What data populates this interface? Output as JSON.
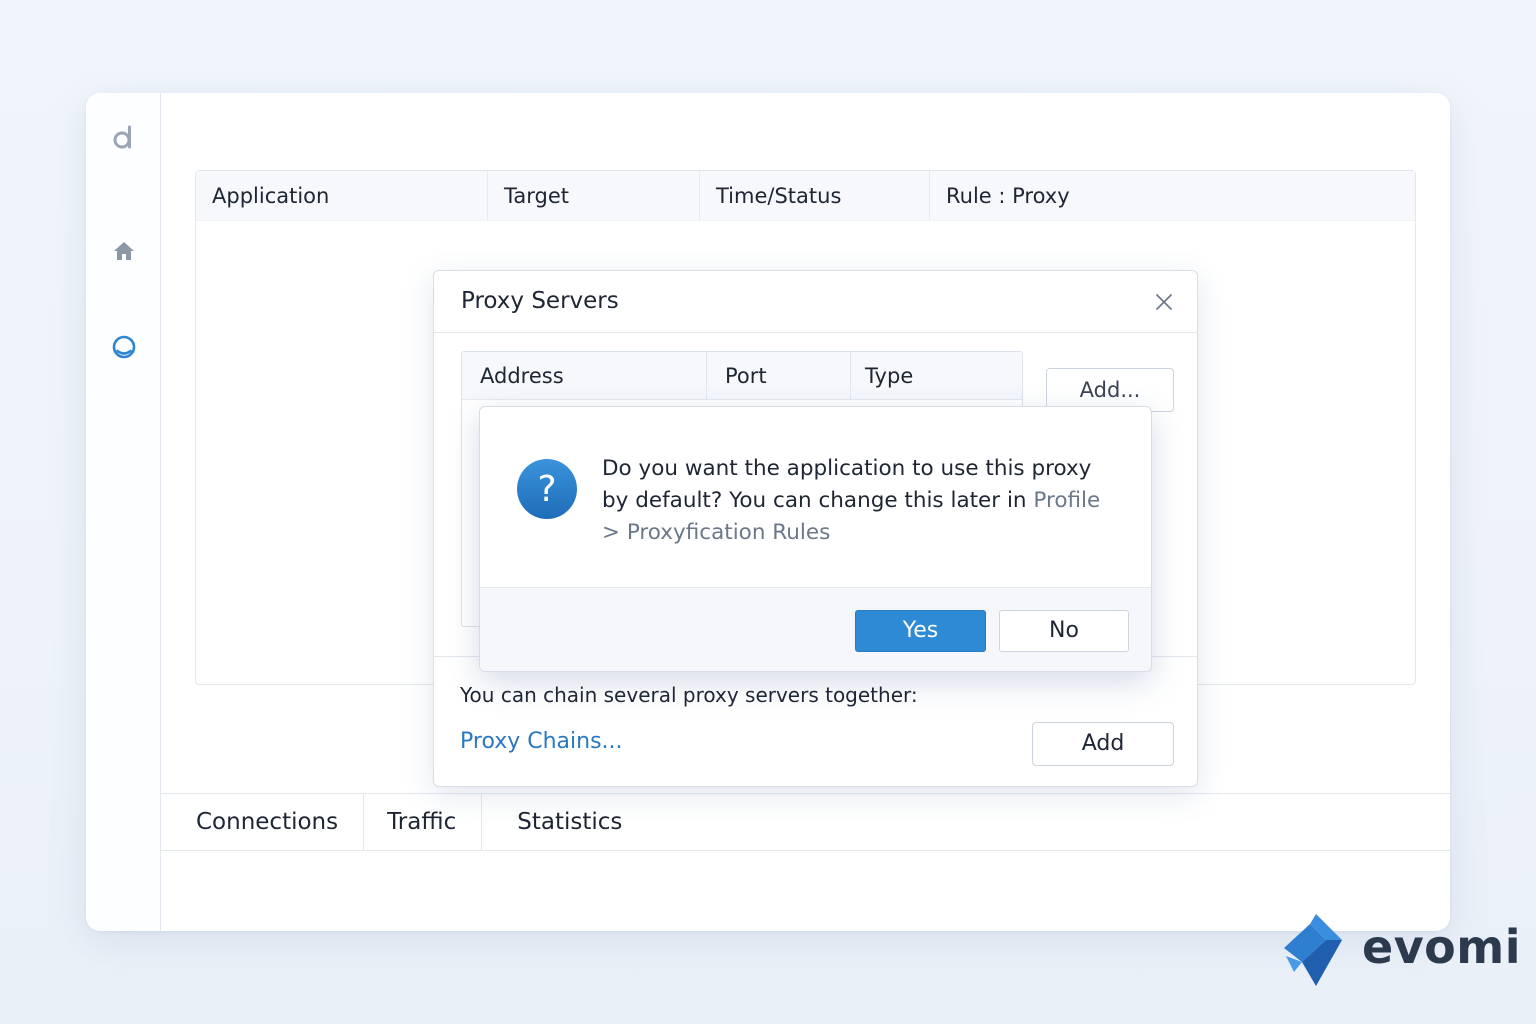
{
  "sidebar": {
    "items": [
      {
        "name": "logo-icon"
      },
      {
        "name": "home-icon"
      },
      {
        "name": "profile-icon"
      }
    ]
  },
  "connections_table": {
    "columns": [
      "Application",
      "Target",
      "Time/Status",
      "Rule : Proxy"
    ]
  },
  "bottom_tabs": [
    "Connections",
    "Traffic",
    "Statistics"
  ],
  "proxy_dialog": {
    "title": "Proxy Servers",
    "close_icon": "close-icon",
    "columns": [
      "Address",
      "Port",
      "Type"
    ],
    "add_dots_label": "Add...",
    "chain_text": "You can chain several proxy servers together:",
    "chain_link": "Proxy Chains...",
    "add_label": "Add"
  },
  "confirm_dialog": {
    "icon": "question-icon",
    "message_main": "Do you want the application to use this proxy by default? You can change this later in ",
    "message_link": "Profile > Proxyfication Rules",
    "yes_label": "Yes",
    "no_label": "No"
  },
  "brand": {
    "name": "evomi",
    "colors": {
      "primary": "#2f7fd0",
      "dark": "#2b3a4d"
    }
  },
  "colors": {
    "accent": "#2f8ad6",
    "link": "#2a78c2",
    "muted_link": "#6b7889"
  }
}
